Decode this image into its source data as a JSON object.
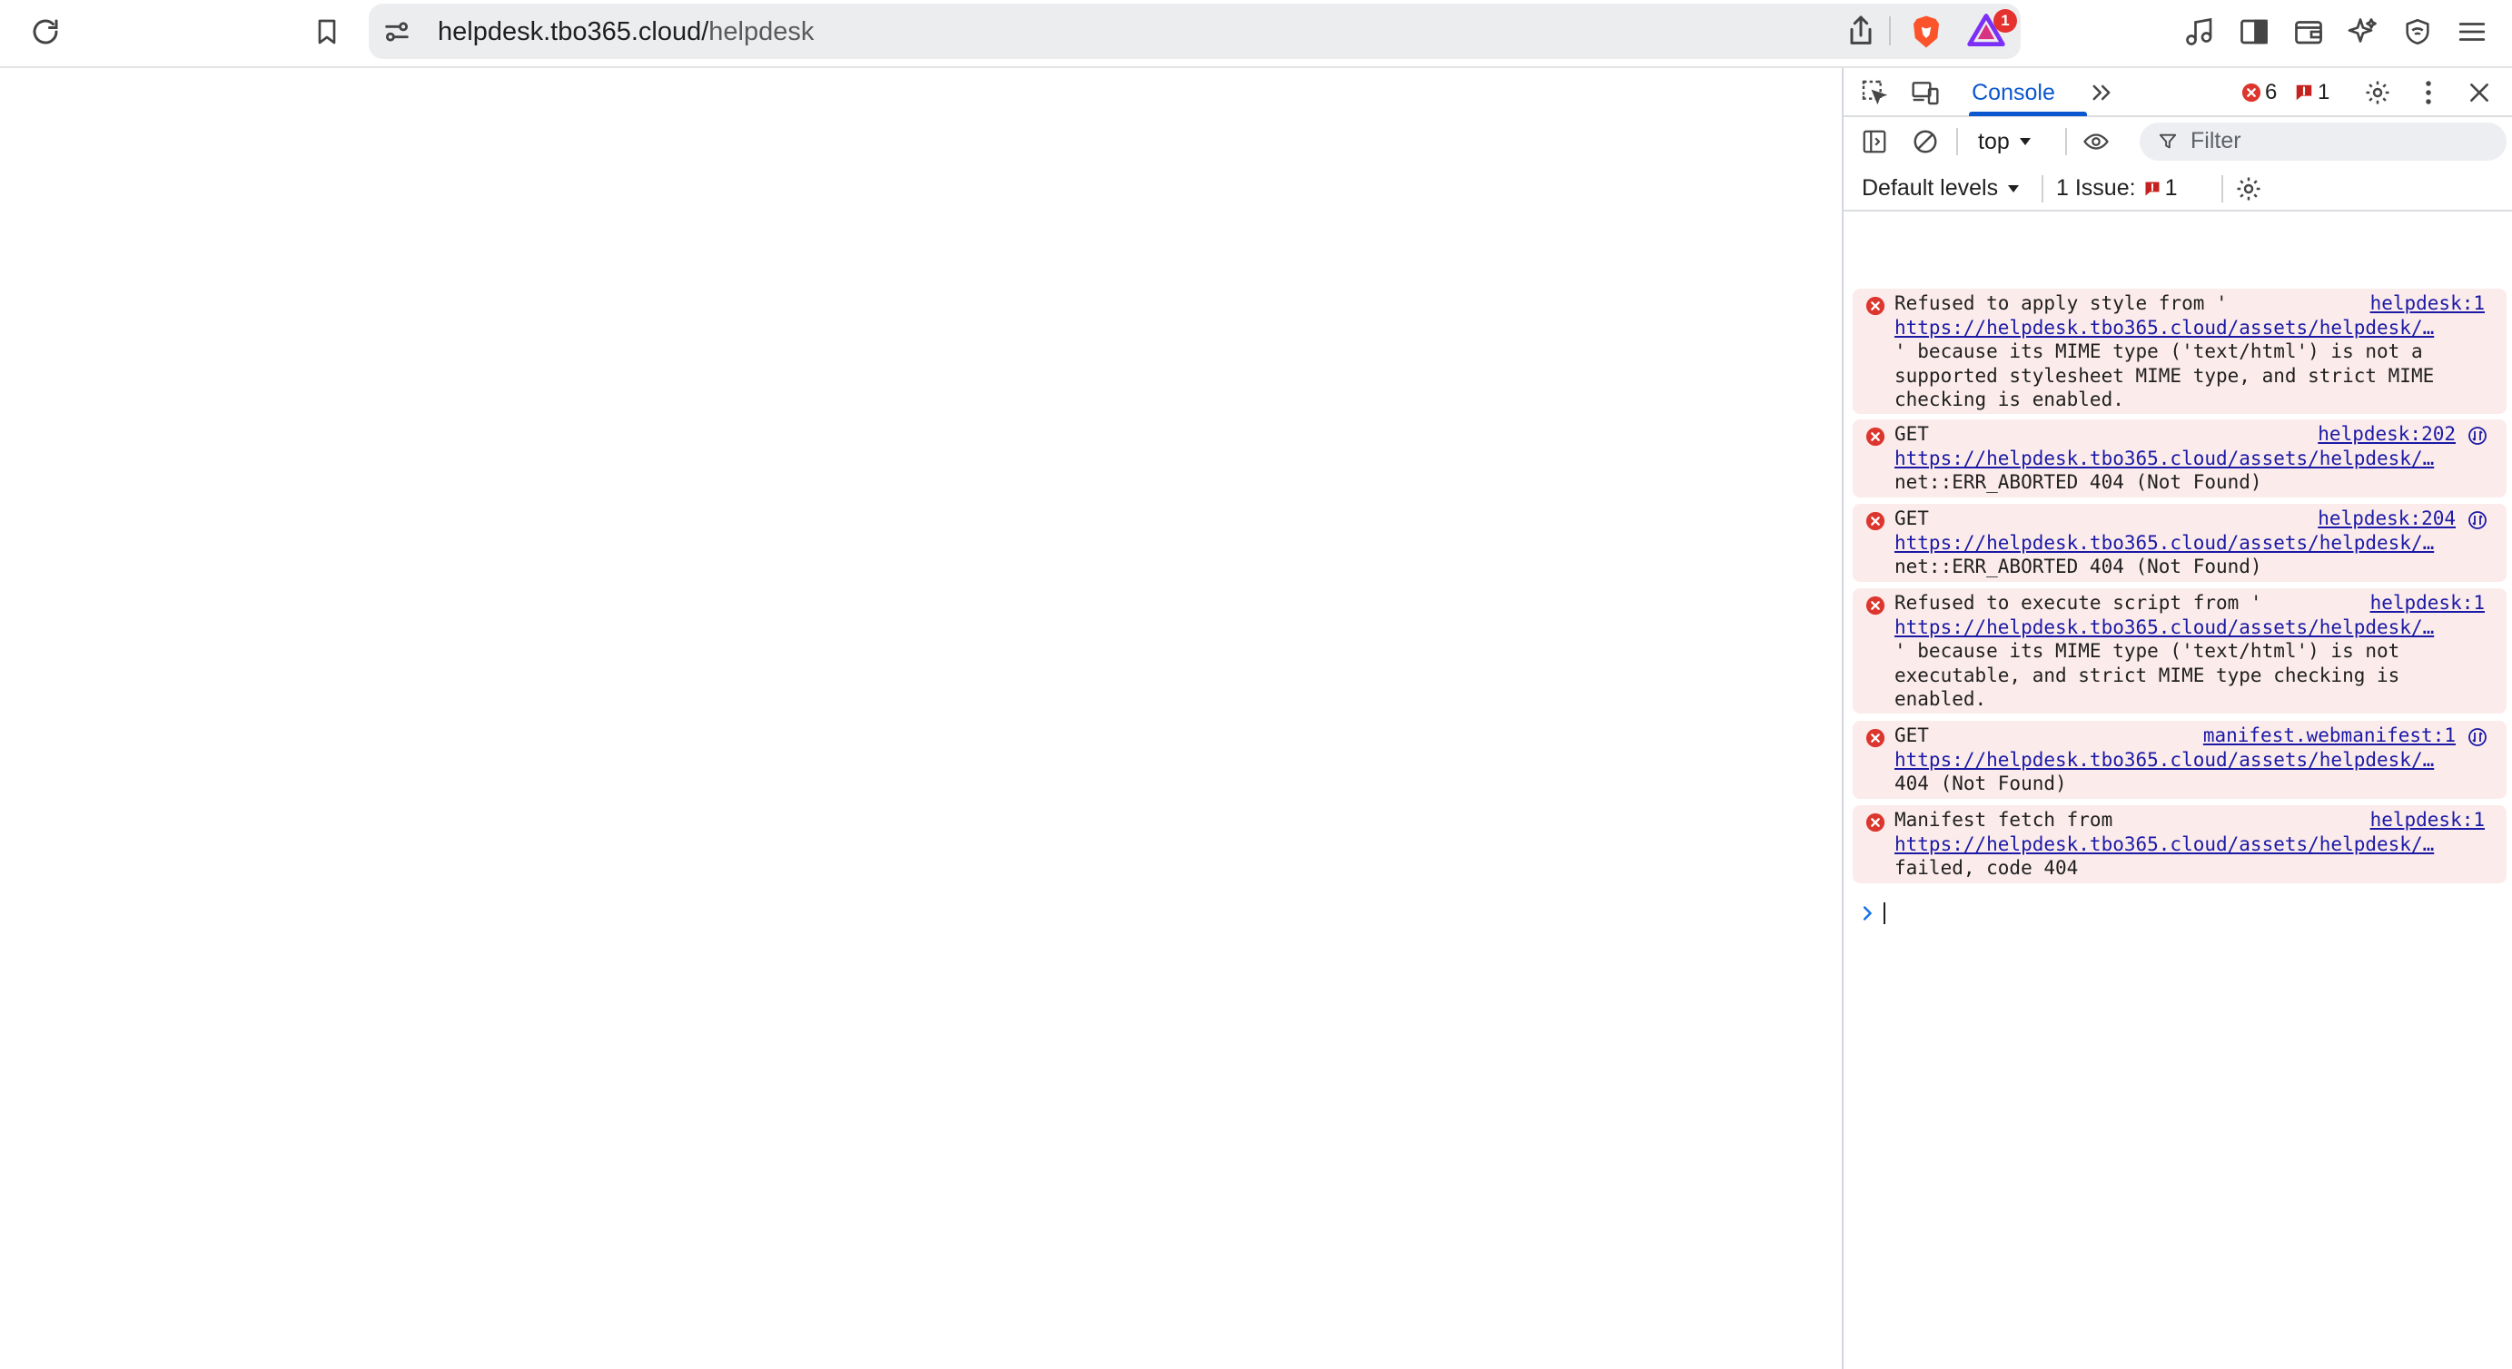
{
  "browser": {
    "url_host": "helpdesk.tbo365.cloud/",
    "url_path": "helpdesk",
    "rewards_badge": "1"
  },
  "devtools": {
    "active_tab": "Console",
    "error_count": "6",
    "issue_count": "1",
    "context": "top",
    "filter_placeholder": "Filter",
    "levels": "Default levels",
    "issues_label": "1 Issue:",
    "issues_badge": "1"
  },
  "messages": [
    {
      "first": "Refused to apply style from '",
      "source": "helpdesk:1",
      "url": "https://helpdesk.tbo365.cloud/assets/helpdesk/…",
      "rest": "' because its MIME type ('text/html') is not a supported stylesheet MIME type, and strict MIME checking is enabled."
    },
    {
      "first": "GET",
      "source": "helpdesk:202",
      "url": "https://helpdesk.tbo365.cloud/assets/helpdesk/…",
      "rest": "net::ERR_ABORTED 404 (Not Found)"
    },
    {
      "first": "GET",
      "source": "helpdesk:204",
      "url": "https://helpdesk.tbo365.cloud/assets/helpdesk/…",
      "rest": "net::ERR_ABORTED 404 (Not Found)"
    },
    {
      "first": "Refused to execute script from '",
      "source": "helpdesk:1",
      "url": "https://helpdesk.tbo365.cloud/assets/helpdesk/…",
      "rest": "' because its MIME type ('text/html') is not executable, and strict MIME type checking is enabled."
    },
    {
      "first": "GET",
      "source": "manifest.webmanifest:1",
      "url": "https://helpdesk.tbo365.cloud/assets/helpdesk/…",
      "rest": "404 (Not Found)"
    },
    {
      "first": "Manifest fetch from",
      "source": "helpdesk:1",
      "url": "https://helpdesk.tbo365.cloud/assets/helpdesk/…",
      "rest": "failed, code 404"
    }
  ],
  "colors": {
    "error_bg": "#fcebeb",
    "error_icon": "#dc362e",
    "link": "#1a1aa6",
    "accent": "#0b57d0"
  }
}
